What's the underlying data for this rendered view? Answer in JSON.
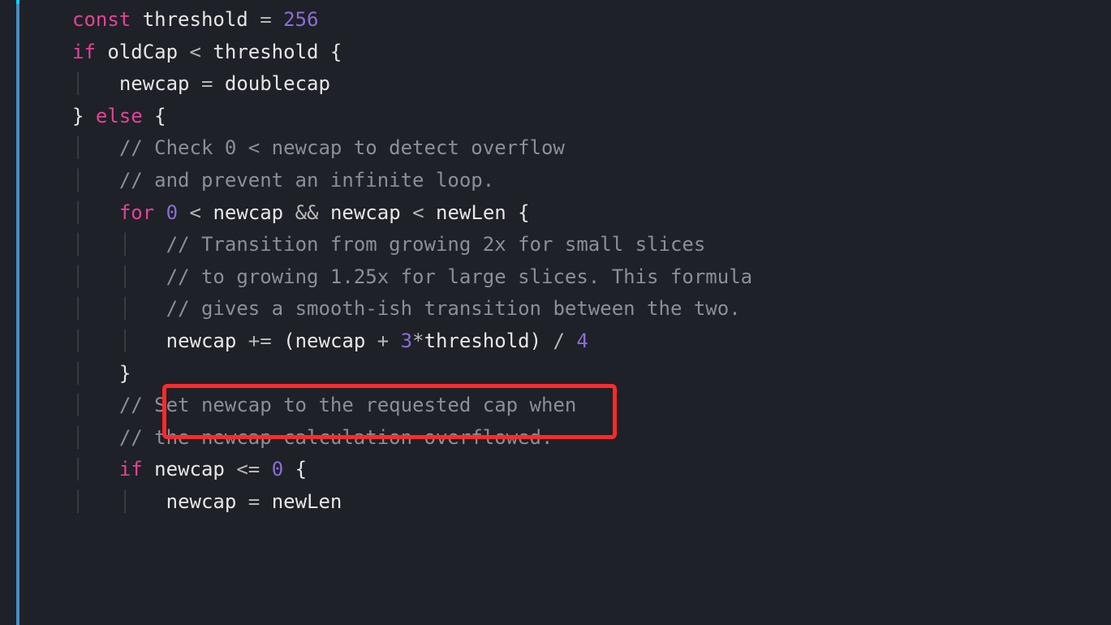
{
  "colors": {
    "bg": "#1e2127",
    "gutter": "#4a8cc4",
    "keyword": "#e64297",
    "number": "#8b6dd6",
    "comment": "#8a8f98",
    "text": "#e6e6e6",
    "highlight_border": "#ff2a2a"
  },
  "code": {
    "lines": [
      {
        "indent": 0,
        "tokens": [
          {
            "t": "kw",
            "v": "const"
          },
          {
            "t": "sp",
            "v": " "
          },
          {
            "t": "ident",
            "v": "threshold"
          },
          {
            "t": "sp",
            "v": " "
          },
          {
            "t": "op",
            "v": "="
          },
          {
            "t": "sp",
            "v": " "
          },
          {
            "t": "num",
            "v": "256"
          }
        ]
      },
      {
        "indent": 0,
        "tokens": [
          {
            "t": "kw",
            "v": "if"
          },
          {
            "t": "sp",
            "v": " "
          },
          {
            "t": "ident",
            "v": "oldCap"
          },
          {
            "t": "sp",
            "v": " "
          },
          {
            "t": "op",
            "v": "<"
          },
          {
            "t": "sp",
            "v": " "
          },
          {
            "t": "ident",
            "v": "threshold"
          },
          {
            "t": "sp",
            "v": " "
          },
          {
            "t": "punc",
            "v": "{"
          }
        ]
      },
      {
        "indent": 1,
        "tokens": [
          {
            "t": "ident",
            "v": "newcap"
          },
          {
            "t": "sp",
            "v": " "
          },
          {
            "t": "op",
            "v": "="
          },
          {
            "t": "sp",
            "v": " "
          },
          {
            "t": "ident",
            "v": "doublecap"
          }
        ]
      },
      {
        "indent": 0,
        "tokens": [
          {
            "t": "punc",
            "v": "}"
          },
          {
            "t": "sp",
            "v": " "
          },
          {
            "t": "kw",
            "v": "else"
          },
          {
            "t": "sp",
            "v": " "
          },
          {
            "t": "punc",
            "v": "{"
          }
        ]
      },
      {
        "indent": 1,
        "tokens": [
          {
            "t": "cmt",
            "v": "// Check 0 < newcap to detect overflow"
          }
        ]
      },
      {
        "indent": 1,
        "tokens": [
          {
            "t": "cmt",
            "v": "// and prevent an infinite loop."
          }
        ]
      },
      {
        "indent": 1,
        "tokens": [
          {
            "t": "kw",
            "v": "for"
          },
          {
            "t": "sp",
            "v": " "
          },
          {
            "t": "num",
            "v": "0"
          },
          {
            "t": "sp",
            "v": " "
          },
          {
            "t": "op",
            "v": "<"
          },
          {
            "t": "sp",
            "v": " "
          },
          {
            "t": "ident",
            "v": "newcap"
          },
          {
            "t": "sp",
            "v": " "
          },
          {
            "t": "op",
            "v": "&&"
          },
          {
            "t": "sp",
            "v": " "
          },
          {
            "t": "ident",
            "v": "newcap"
          },
          {
            "t": "sp",
            "v": " "
          },
          {
            "t": "op",
            "v": "<"
          },
          {
            "t": "sp",
            "v": " "
          },
          {
            "t": "ident",
            "v": "newLen"
          },
          {
            "t": "sp",
            "v": " "
          },
          {
            "t": "punc",
            "v": "{"
          }
        ]
      },
      {
        "indent": 2,
        "tokens": [
          {
            "t": "cmt",
            "v": "// Transition from growing 2x for small slices"
          }
        ]
      },
      {
        "indent": 2,
        "tokens": [
          {
            "t": "cmt",
            "v": "// to growing 1.25x for large slices. This formula"
          }
        ]
      },
      {
        "indent": 2,
        "tokens": [
          {
            "t": "cmt",
            "v": "// gives a smooth-ish transition between the two."
          }
        ]
      },
      {
        "indent": 2,
        "tokens": [
          {
            "t": "ident",
            "v": "newcap"
          },
          {
            "t": "sp",
            "v": " "
          },
          {
            "t": "op",
            "v": "+="
          },
          {
            "t": "sp",
            "v": " "
          },
          {
            "t": "punc",
            "v": "("
          },
          {
            "t": "ident",
            "v": "newcap"
          },
          {
            "t": "sp",
            "v": " "
          },
          {
            "t": "op",
            "v": "+"
          },
          {
            "t": "sp",
            "v": " "
          },
          {
            "t": "num",
            "v": "3"
          },
          {
            "t": "op",
            "v": "*"
          },
          {
            "t": "ident",
            "v": "threshold"
          },
          {
            "t": "punc",
            "v": ")"
          },
          {
            "t": "sp",
            "v": " "
          },
          {
            "t": "op",
            "v": "/"
          },
          {
            "t": "sp",
            "v": " "
          },
          {
            "t": "num",
            "v": "4"
          }
        ]
      },
      {
        "indent": 1,
        "tokens": [
          {
            "t": "punc",
            "v": "}"
          }
        ]
      },
      {
        "indent": 1,
        "tokens": [
          {
            "t": "cmt",
            "v": "// Set newcap to the requested cap when"
          }
        ]
      },
      {
        "indent": 1,
        "tokens": [
          {
            "t": "cmt",
            "v": "// the newcap calculation overflowed."
          }
        ]
      },
      {
        "indent": 1,
        "tokens": [
          {
            "t": "kw",
            "v": "if"
          },
          {
            "t": "sp",
            "v": " "
          },
          {
            "t": "ident",
            "v": "newcap"
          },
          {
            "t": "sp",
            "v": " "
          },
          {
            "t": "op",
            "v": "<="
          },
          {
            "t": "sp",
            "v": " "
          },
          {
            "t": "num",
            "v": "0"
          },
          {
            "t": "sp",
            "v": " "
          },
          {
            "t": "punc",
            "v": "{"
          }
        ]
      },
      {
        "indent": 2,
        "tokens": [
          {
            "t": "ident",
            "v": "newcap"
          },
          {
            "t": "sp",
            "v": " "
          },
          {
            "t": "op",
            "v": "="
          },
          {
            "t": "sp",
            "v": " "
          },
          {
            "t": "ident",
            "v": "newLen"
          }
        ]
      }
    ]
  },
  "highlight": {
    "line_index": 10,
    "description": "newcap += (newcap + 3*threshold) / 4"
  }
}
